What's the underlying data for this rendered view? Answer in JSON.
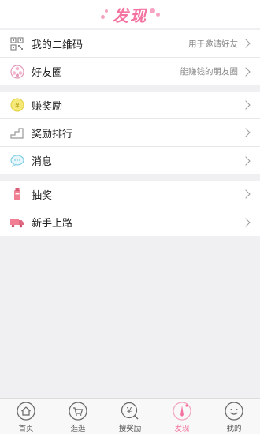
{
  "header": {
    "title": "发现"
  },
  "groups": [
    [
      {
        "label": "我的二维码",
        "hint": "用于邀请好友",
        "icon": "qr-code-icon"
      },
      {
        "label": "好友圈",
        "hint": "能赚钱的朋友圈",
        "icon": "friends-circle-icon"
      }
    ],
    [
      {
        "label": "赚奖励",
        "hint": "",
        "icon": "coin-icon"
      },
      {
        "label": "奖励排行",
        "hint": "",
        "icon": "ranking-stairs-icon"
      },
      {
        "label": "消息",
        "hint": "",
        "icon": "message-bubble-icon"
      }
    ],
    [
      {
        "label": "抽奖",
        "hint": "",
        "icon": "lottery-icon"
      },
      {
        "label": "新手上路",
        "hint": "",
        "icon": "truck-icon"
      }
    ]
  ],
  "tabs": [
    {
      "label": "首页",
      "icon": "home-icon",
      "active": false
    },
    {
      "label": "逛逛",
      "icon": "cart-icon",
      "active": false
    },
    {
      "label": "搜奖励",
      "icon": "yuan-search-icon",
      "active": false
    },
    {
      "label": "发现",
      "icon": "discover-icon",
      "active": true
    },
    {
      "label": "我的",
      "icon": "smiley-icon",
      "active": false
    }
  ],
  "colors": {
    "accent": "#f3729f",
    "background": "#f0f0f3"
  }
}
